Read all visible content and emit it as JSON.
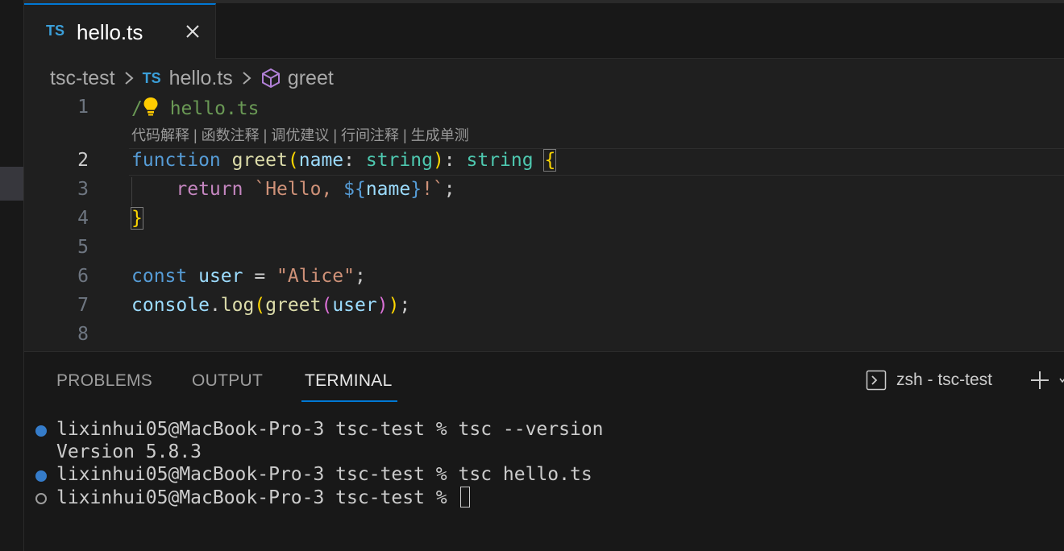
{
  "tab": {
    "icon_text": "TS",
    "title": "hello.ts"
  },
  "breadcrumb": {
    "folder": "tsc-test",
    "file_icon_text": "TS",
    "file": "hello.ts",
    "symbol": "greet"
  },
  "editor": {
    "line_numbers": [
      "1",
      "2",
      "3",
      "4",
      "5",
      "6",
      "7",
      "8"
    ],
    "codelens": "代码解释 | 函数注释 | 调优建议 | 行间注释 | 生成单测",
    "line1": {
      "comment_head": "/",
      "comment_tail": " hello.ts"
    },
    "line2": {
      "kw": "function",
      "sp": " ",
      "fn": "greet",
      "open": "(",
      "param": "name",
      "colon": ": ",
      "type1": "string",
      "close": ")",
      "colon2": ": ",
      "type2": "string",
      "sp2": " ",
      "brace": "{"
    },
    "line3": {
      "indent": "    ",
      "kw": "return",
      "sp": " ",
      "str1": "`Hello, ",
      "interp_open": "${",
      "var": "name",
      "interp_close": "}",
      "str2": "!`",
      "semi": ";"
    },
    "line4": {
      "brace": "}"
    },
    "line6": {
      "kw": "const",
      "sp": " ",
      "var": "user",
      "eq": " = ",
      "str": "\"Alice\"",
      "semi": ";"
    },
    "line7": {
      "obj": "console",
      "dot": ".",
      "fn1": "log",
      "p1": "(",
      "fn2": "greet",
      "p2": "(",
      "arg": "user",
      "p2c": ")",
      "p1c": ")",
      "semi": ";"
    }
  },
  "panel": {
    "tabs": [
      "PROBLEMS",
      "OUTPUT",
      "TERMINAL"
    ],
    "terminal_name": "zsh - tsc-test"
  },
  "terminal": {
    "lines": [
      "lixinhui05@MacBook-Pro-3 tsc-test % tsc --version",
      "Version 5.8.3",
      "lixinhui05@MacBook-Pro-3 tsc-test % tsc hello.ts",
      "lixinhui05@MacBook-Pro-3 tsc-test % "
    ]
  },
  "colors": {
    "accent": "#0078d4",
    "keyword": "#569cd6",
    "function": "#dcdcaa",
    "variable": "#9cdcfe",
    "type": "#4ec9b0",
    "string": "#ce9178",
    "comment": "#6a9955"
  },
  "icons": [
    "close-icon",
    "chevron-right-icon",
    "symbol-method-icon",
    "lightbulb-icon",
    "terminal-icon",
    "plus-icon",
    "chevron-down-icon"
  ]
}
